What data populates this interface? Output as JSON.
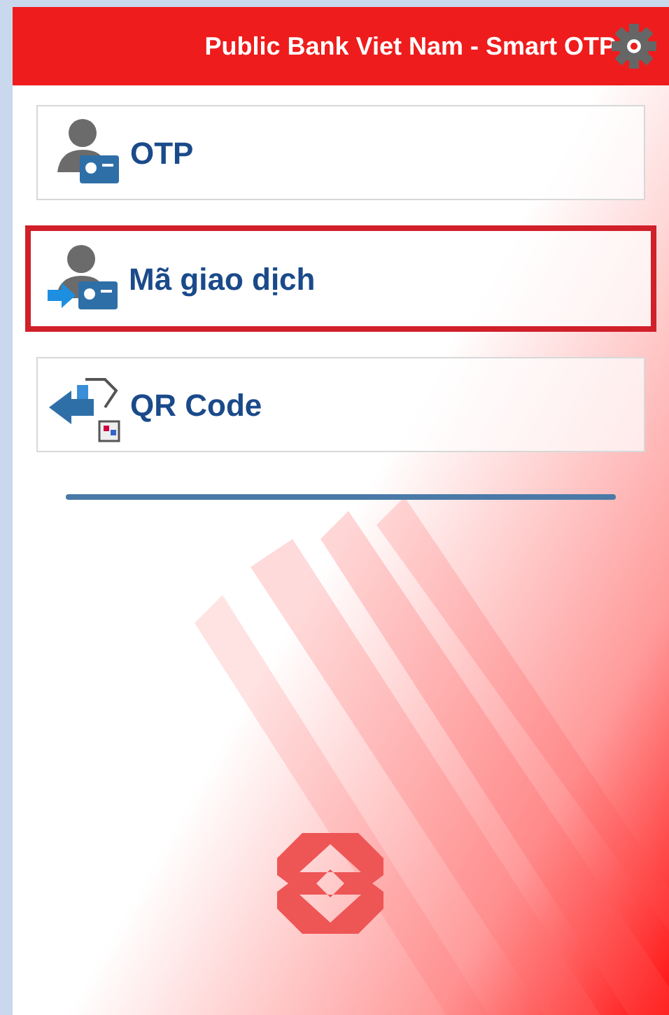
{
  "header": {
    "title": "Public Bank Viet Nam - Smart OTP"
  },
  "menu": [
    {
      "kind": "otp",
      "label": "OTP",
      "selected": false
    },
    {
      "kind": "transaction",
      "label": "Mã giao dịch",
      "selected": true
    },
    {
      "kind": "qr",
      "label": "QR Code",
      "selected": false
    }
  ]
}
